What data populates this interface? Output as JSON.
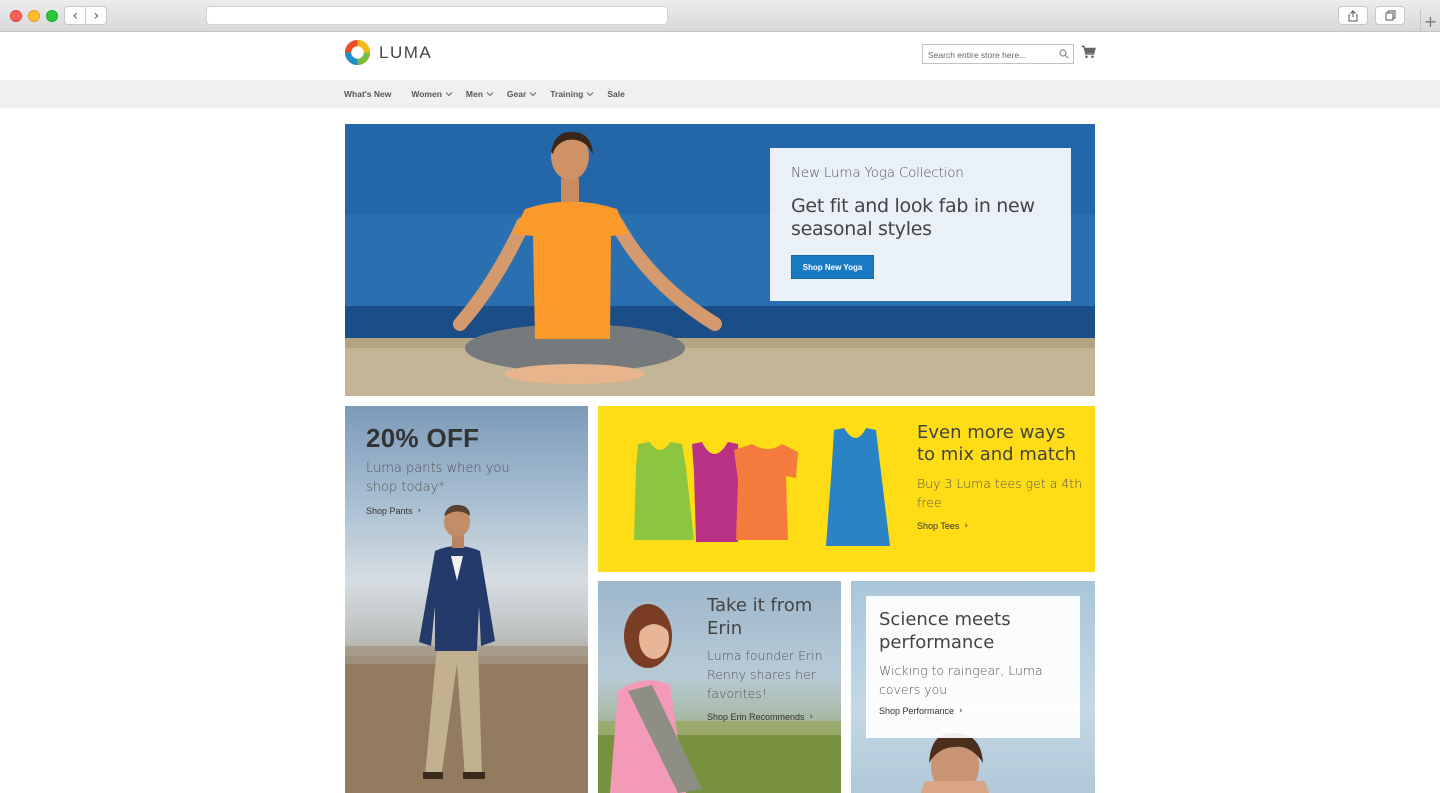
{
  "browser": {
    "back_glyph": "‹",
    "forward_glyph": "›",
    "new_tab_glyph": "+"
  },
  "header": {
    "logo_text": "LUMA",
    "search_placeholder": "Search entire store here...",
    "icons": [
      "luma-logo-icon",
      "search-icon",
      "cart-icon"
    ]
  },
  "nav": {
    "items": [
      {
        "label": "What's New",
        "has_dropdown": false
      },
      {
        "label": "Women",
        "has_dropdown": true
      },
      {
        "label": "Men",
        "has_dropdown": true
      },
      {
        "label": "Gear",
        "has_dropdown": true
      },
      {
        "label": "Training",
        "has_dropdown": true
      },
      {
        "label": "Sale",
        "has_dropdown": false
      }
    ]
  },
  "hero": {
    "eyebrow": "New Luma Yoga Collection",
    "title": "Get fit and look fab in new seasonal styles",
    "button_label": "Shop New Yoga"
  },
  "promos": {
    "pants": {
      "headline": "20% OFF",
      "subtitle": "Luma pants when you shop today*",
      "link": "Shop Pants"
    },
    "tees": {
      "title": "Even more ways to mix and match",
      "subtitle": "Buy 3 Luma tees get a 4th free",
      "link": "Shop Tees"
    },
    "erin": {
      "title": "Take it from Erin",
      "subtitle": "Luma founder Erin Renny shares her favorites!",
      "link": "Shop Erin Recommends"
    },
    "performance": {
      "title": "Science meets performance",
      "subtitle": "Wicking to raingear, Luma covers you",
      "link": "Shop Performance"
    }
  },
  "link_arrow": "›",
  "colors": {
    "primary_button": "#1979c3",
    "tees_background": "#ffdd16",
    "nav_background": "#f0f0f0"
  }
}
